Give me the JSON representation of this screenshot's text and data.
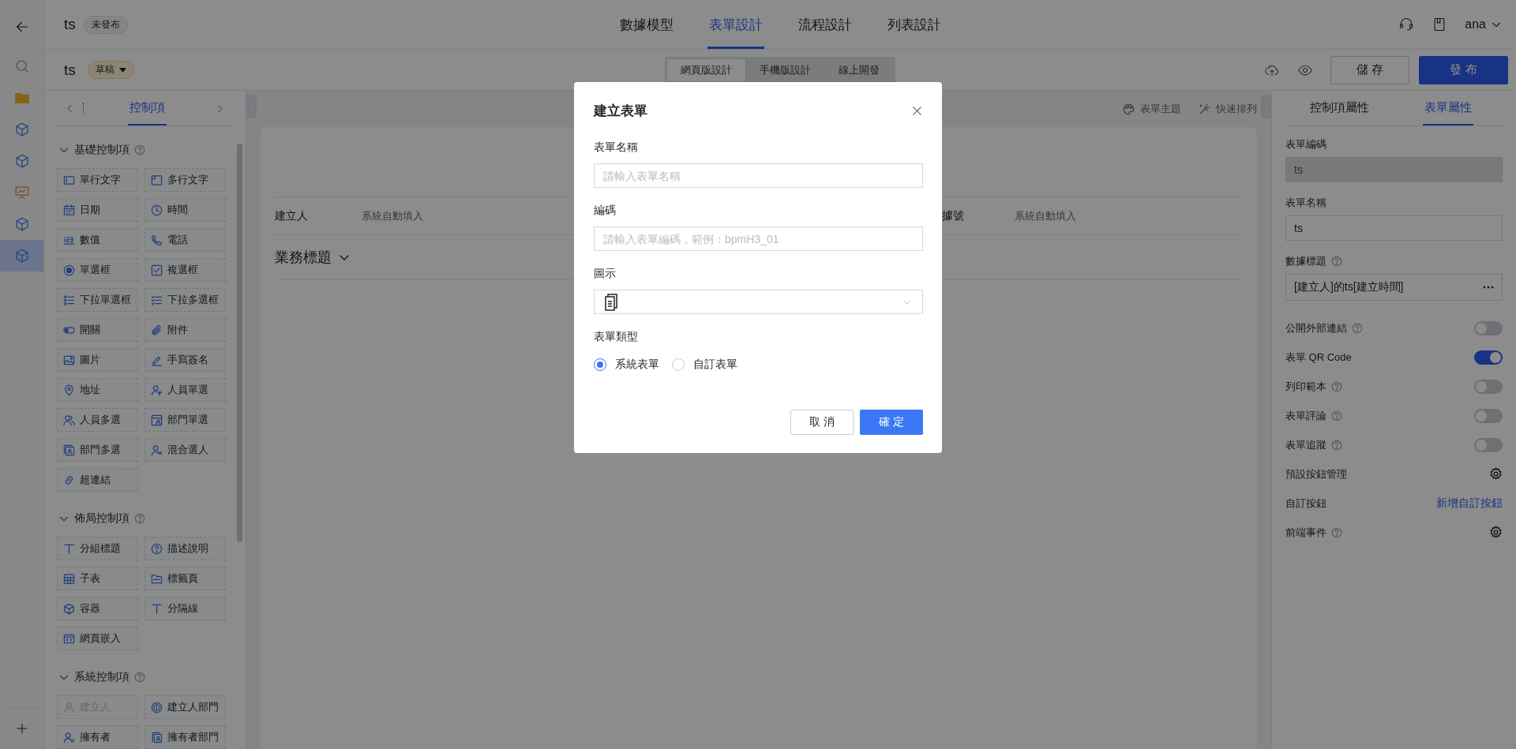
{
  "rail": {
    "items": [
      {
        "kind": "back",
        "selected": false
      },
      {
        "kind": "search",
        "selected": false
      },
      {
        "kind": "folder",
        "selected": false
      },
      {
        "kind": "cube",
        "selected": false
      },
      {
        "kind": "cube",
        "selected": false
      },
      {
        "kind": "board",
        "selected": false
      },
      {
        "kind": "cube",
        "selected": false
      },
      {
        "kind": "cube",
        "selected": true
      }
    ]
  },
  "topbar": {
    "app_title": "ts",
    "status_badge": "未發布",
    "tabs": [
      {
        "label": "數據模型",
        "selected": false
      },
      {
        "label": "表單設計",
        "selected": true
      },
      {
        "label": "流程設計",
        "selected": false
      },
      {
        "label": "列表設計",
        "selected": false
      }
    ],
    "user": "ana"
  },
  "toolbar": {
    "form_name": "ts",
    "version_badge": "草稿",
    "design_modes": [
      {
        "label": "網頁版設計",
        "selected": true
      },
      {
        "label": "手機版設計",
        "selected": false
      },
      {
        "label": "線上開發",
        "selected": false
      }
    ],
    "save": "儲 存",
    "publish": "發 布"
  },
  "controls_panel": {
    "tabs": [
      {
        "label": "控制項",
        "selected": true
      }
    ],
    "sections": [
      {
        "title": "基礎控制項",
        "expanded": true,
        "items": [
          {
            "kind": "text-line",
            "label": "單行文字"
          },
          {
            "kind": "text-area",
            "label": "多行文字"
          },
          {
            "kind": "date",
            "label": "日期"
          },
          {
            "kind": "time",
            "label": "時間"
          },
          {
            "kind": "number",
            "label": "數值"
          },
          {
            "kind": "phone",
            "label": "電話"
          },
          {
            "kind": "radio",
            "label": "單選框"
          },
          {
            "kind": "checkbox",
            "label": "複選框"
          },
          {
            "kind": "select-single",
            "label": "下拉單選框"
          },
          {
            "kind": "select-multi",
            "label": "下拉多選框"
          },
          {
            "kind": "switch",
            "label": "開關"
          },
          {
            "kind": "attachment",
            "label": "附件"
          },
          {
            "kind": "image",
            "label": "圖片"
          },
          {
            "kind": "signature",
            "label": "手寫簽名"
          },
          {
            "kind": "address",
            "label": "地址"
          },
          {
            "kind": "user",
            "label": "人員單選"
          },
          {
            "kind": "users",
            "label": "人員多選"
          },
          {
            "kind": "dept",
            "label": "部門單選"
          },
          {
            "kind": "dept-multi",
            "label": "部門多選"
          },
          {
            "kind": "mixed",
            "label": "混合選人"
          },
          {
            "kind": "link",
            "label": "超連結"
          }
        ]
      },
      {
        "title": "佈局控制項",
        "expanded": true,
        "items": [
          {
            "kind": "title",
            "label": "分組標題"
          },
          {
            "kind": "description",
            "label": "描述說明"
          },
          {
            "kind": "table",
            "label": "子表"
          },
          {
            "kind": "tabs",
            "label": "標籤頁"
          },
          {
            "kind": "container",
            "label": "容器"
          },
          {
            "kind": "divider",
            "label": "分隔線"
          },
          {
            "kind": "embed",
            "label": "網頁嵌入"
          }
        ]
      },
      {
        "title": "系統控制項",
        "expanded": true,
        "items": [
          {
            "kind": "creator",
            "label": "建立人",
            "disabled": true
          },
          {
            "kind": "creator-dept",
            "label": "建立人部門",
            "disabled": false
          },
          {
            "kind": "owner",
            "label": "擁有者",
            "disabled": false
          },
          {
            "kind": "owner-dept",
            "label": "擁有者部門",
            "disabled": false
          }
        ]
      }
    ]
  },
  "canvas": {
    "tools": [
      {
        "kind": "theme",
        "label": "表單主題"
      },
      {
        "kind": "arrange",
        "label": "快速排列"
      }
    ],
    "fields": [
      {
        "label": "建立人",
        "value": "系統自動填入"
      },
      {
        "label": "據號",
        "value": "系統自動填入"
      }
    ],
    "section_title": "業務標題"
  },
  "properties": {
    "tabs": [
      {
        "label": "控制項屬性",
        "selected": false
      },
      {
        "label": "表單屬性",
        "selected": true
      }
    ],
    "items": [
      {
        "kind": "input",
        "label": "表單編碼",
        "value": "ts",
        "disabled": true,
        "help": false
      },
      {
        "kind": "input",
        "label": "表單名稱",
        "value": "ts",
        "disabled": false,
        "help": false
      },
      {
        "kind": "picker",
        "label": "數據標題",
        "value": "[建立人]的ts[建立時間]",
        "help": true
      },
      {
        "kind": "switch",
        "label": "公開外部連結",
        "on": false,
        "help": true
      },
      {
        "kind": "switch",
        "label": "表單 QR Code",
        "on": true,
        "help": false
      },
      {
        "kind": "switch",
        "label": "列印範本",
        "on": false,
        "help": true
      },
      {
        "kind": "switch",
        "label": "表單評論",
        "on": false,
        "help": true
      },
      {
        "kind": "switch",
        "label": "表單追蹤",
        "on": false,
        "help": true
      },
      {
        "kind": "gear",
        "label": "預設按鈕管理",
        "help": false
      },
      {
        "kind": "link",
        "label": "自訂按鈕",
        "link": "新增自訂按鈕",
        "help": false
      },
      {
        "kind": "gear",
        "label": "前端事件",
        "help": true
      }
    ]
  },
  "dialog": {
    "title": "建立表單",
    "fields": [
      {
        "kind": "text",
        "label": "表單名稱",
        "placeholder": "請輸入表單名稱"
      },
      {
        "kind": "text",
        "label": "編碼",
        "placeholder": "請輸入表單編碼，範例：bpmH3_01"
      },
      {
        "kind": "icon-select",
        "label": "圖示"
      },
      {
        "kind": "radio",
        "label": "表單類型",
        "options": [
          {
            "label": "系統表單",
            "selected": true
          },
          {
            "label": "自訂表單",
            "selected": false
          }
        ]
      }
    ],
    "buttons": [
      {
        "kind": "secondary",
        "label": "取 消"
      },
      {
        "kind": "primary",
        "label": "確 定"
      }
    ]
  }
}
